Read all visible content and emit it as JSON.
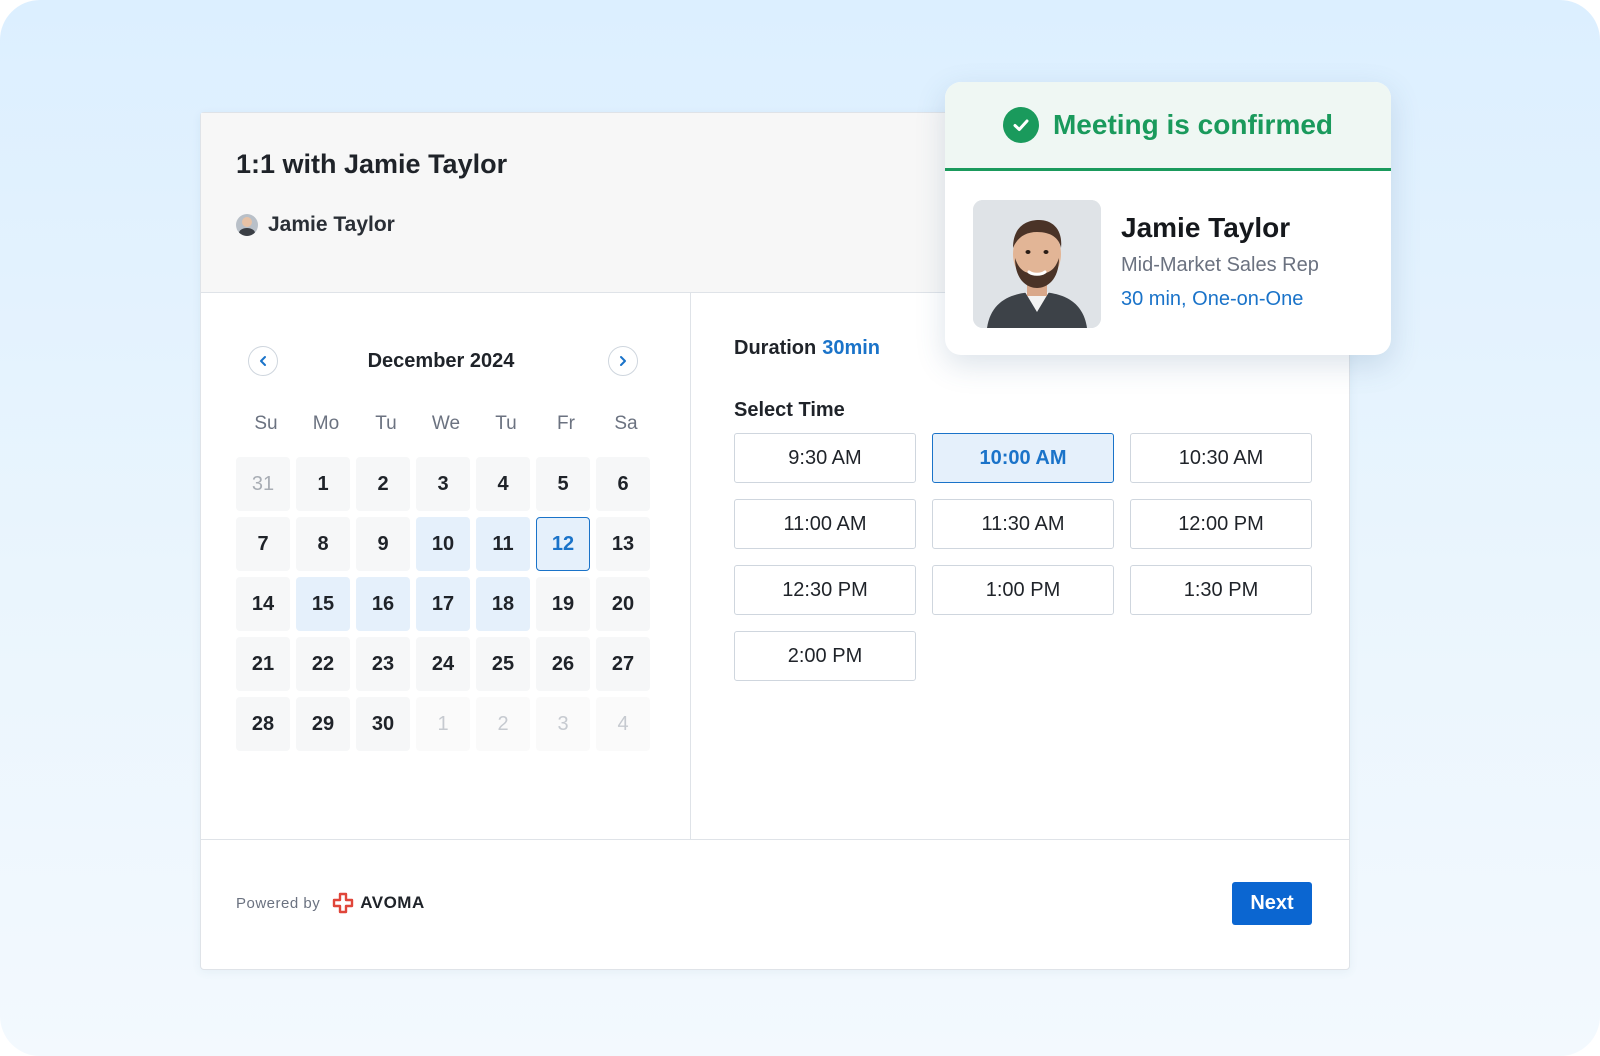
{
  "event": {
    "title": "1:1 with Jamie Taylor",
    "host_name": "Jamie Taylor"
  },
  "calendar": {
    "month_label": "December 2024",
    "prev_icon": "chevron-left-icon",
    "next_icon": "chevron-right-icon",
    "weekdays": [
      "Su",
      "Mo",
      "Tu",
      "We",
      "Tu",
      "Fr",
      "Sa"
    ],
    "days": [
      {
        "label": "31",
        "state": "muted"
      },
      {
        "label": "1",
        "state": "normal"
      },
      {
        "label": "2",
        "state": "normal"
      },
      {
        "label": "3",
        "state": "normal"
      },
      {
        "label": "4",
        "state": "normal"
      },
      {
        "label": "5",
        "state": "normal"
      },
      {
        "label": "6",
        "state": "normal"
      },
      {
        "label": "7",
        "state": "normal"
      },
      {
        "label": "8",
        "state": "normal"
      },
      {
        "label": "9",
        "state": "normal"
      },
      {
        "label": "10",
        "state": "available"
      },
      {
        "label": "11",
        "state": "available"
      },
      {
        "label": "12",
        "state": "selected"
      },
      {
        "label": "13",
        "state": "normal"
      },
      {
        "label": "14",
        "state": "normal"
      },
      {
        "label": "15",
        "state": "available"
      },
      {
        "label": "16",
        "state": "available"
      },
      {
        "label": "17",
        "state": "available"
      },
      {
        "label": "18",
        "state": "available"
      },
      {
        "label": "19",
        "state": "normal"
      },
      {
        "label": "20",
        "state": "normal"
      },
      {
        "label": "21",
        "state": "normal"
      },
      {
        "label": "22",
        "state": "normal"
      },
      {
        "label": "23",
        "state": "normal"
      },
      {
        "label": "24",
        "state": "normal"
      },
      {
        "label": "25",
        "state": "normal"
      },
      {
        "label": "26",
        "state": "normal"
      },
      {
        "label": "27",
        "state": "normal"
      },
      {
        "label": "28",
        "state": "normal"
      },
      {
        "label": "29",
        "state": "normal"
      },
      {
        "label": "30",
        "state": "normal"
      },
      {
        "label": "1",
        "state": "outside"
      },
      {
        "label": "2",
        "state": "outside"
      },
      {
        "label": "3",
        "state": "outside"
      },
      {
        "label": "4",
        "state": "outside"
      }
    ]
  },
  "times": {
    "duration_label": "Duration",
    "duration_value": "30min",
    "select_label": "Select Time",
    "slots": [
      {
        "label": "9:30 AM",
        "active": false
      },
      {
        "label": "10:00 AM",
        "active": true
      },
      {
        "label": "10:30 AM",
        "active": false
      },
      {
        "label": "11:00 AM",
        "active": false
      },
      {
        "label": "11:30 AM",
        "active": false
      },
      {
        "label": "12:00 PM",
        "active": false
      },
      {
        "label": "12:30 PM",
        "active": false
      },
      {
        "label": "1:00 PM",
        "active": false
      },
      {
        "label": "1:30 PM",
        "active": false
      },
      {
        "label": "2:00 PM",
        "active": false
      }
    ]
  },
  "footer": {
    "powered_by": "Powered by",
    "brand": "AVOMA",
    "next_label": "Next"
  },
  "confirmation": {
    "title": "Meeting is confirmed",
    "name": "Jamie Taylor",
    "role": "Mid-Market Sales Rep",
    "meta": "30 min, One-on-One"
  },
  "colors": {
    "accent": "#1a73c9",
    "primary_button": "#0b66d1",
    "success": "#1a9a5c",
    "brand": "#e0463a"
  }
}
